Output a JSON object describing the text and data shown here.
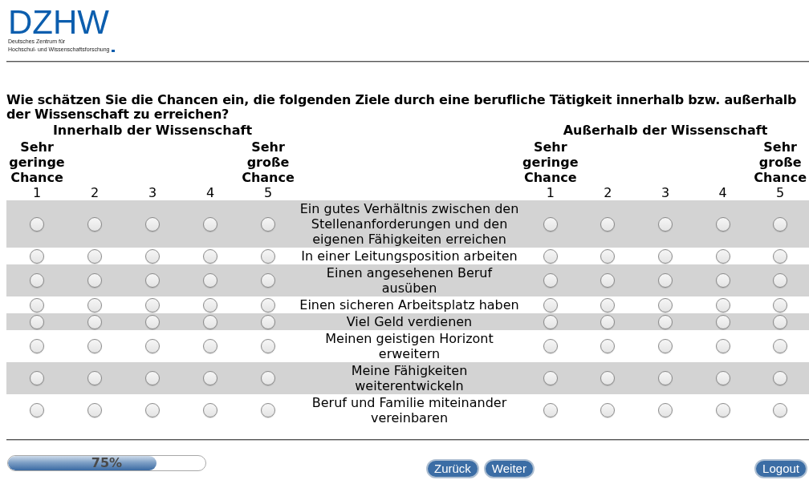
{
  "logo": {
    "wordmark": "DZHW",
    "subtitle_lines": [
      "Deutsches Zentrum für",
      "Hochschul- und Wissenschaftsforschung"
    ]
  },
  "question": "Wie schätzen Sie die Chancen ein, die folgenden Ziele durch eine berufliche Tätigkeit innerhalb bzw. außerhalb der Wissenschaft zu erreichen?",
  "scales": [
    {
      "title": "Innerhalb der Wissenschaft",
      "points": [
        {
          "label": "Sehr geringe Chance",
          "number": "1"
        },
        {
          "number": "2"
        },
        {
          "number": "3"
        },
        {
          "number": "4"
        },
        {
          "label": "Sehr große Chance",
          "number": "5"
        }
      ]
    },
    {
      "title": "Außerhalb der Wissenschaft",
      "points": [
        {
          "label": "Sehr geringe Chance",
          "number": "1"
        },
        {
          "number": "2"
        },
        {
          "number": "3"
        },
        {
          "number": "4"
        },
        {
          "label": "Sehr große Chance",
          "number": "5"
        }
      ]
    }
  ],
  "items": [
    {
      "text": "Ein gutes Verhältnis zwischen den Stellenanforderungen und den eigenen Fähigkeiten erreichen",
      "responses": [
        [
          {
            "selected": false
          },
          {
            "selected": false
          },
          {
            "selected": false
          },
          {
            "selected": false
          },
          {
            "selected": false
          }
        ],
        [
          {
            "selected": false
          },
          {
            "selected": false
          },
          {
            "selected": false
          },
          {
            "selected": false
          },
          {
            "selected": false
          }
        ]
      ]
    },
    {
      "text": "In einer Leitungsposition arbeiten",
      "responses": [
        [
          {
            "selected": false
          },
          {
            "selected": false
          },
          {
            "selected": false
          },
          {
            "selected": false
          },
          {
            "selected": false
          }
        ],
        [
          {
            "selected": false
          },
          {
            "selected": false
          },
          {
            "selected": false
          },
          {
            "selected": false
          },
          {
            "selected": false
          }
        ]
      ]
    },
    {
      "text": "Einen angesehenen Beruf ausüben",
      "responses": [
        [
          {
            "selected": false
          },
          {
            "selected": false
          },
          {
            "selected": false
          },
          {
            "selected": false
          },
          {
            "selected": false
          }
        ],
        [
          {
            "selected": false
          },
          {
            "selected": false
          },
          {
            "selected": false
          },
          {
            "selected": false
          },
          {
            "selected": false
          }
        ]
      ]
    },
    {
      "text": "Einen sicheren Arbeitsplatz haben",
      "responses": [
        [
          {
            "selected": false
          },
          {
            "selected": false
          },
          {
            "selected": false
          },
          {
            "selected": false
          },
          {
            "selected": false
          }
        ],
        [
          {
            "selected": false
          },
          {
            "selected": false
          },
          {
            "selected": false
          },
          {
            "selected": false
          },
          {
            "selected": false
          }
        ]
      ]
    },
    {
      "text": "Viel Geld verdienen",
      "responses": [
        [
          {
            "selected": false
          },
          {
            "selected": false
          },
          {
            "selected": false
          },
          {
            "selected": false
          },
          {
            "selected": false
          }
        ],
        [
          {
            "selected": false
          },
          {
            "selected": false
          },
          {
            "selected": false
          },
          {
            "selected": false
          },
          {
            "selected": false
          }
        ]
      ]
    },
    {
      "text": "Meinen geistigen Horizont erweitern",
      "responses": [
        [
          {
            "selected": false
          },
          {
            "selected": false
          },
          {
            "selected": false
          },
          {
            "selected": false
          },
          {
            "selected": false
          }
        ],
        [
          {
            "selected": false
          },
          {
            "selected": false
          },
          {
            "selected": false
          },
          {
            "selected": false
          },
          {
            "selected": false
          }
        ]
      ]
    },
    {
      "text": "Meine Fähigkeiten weiterentwickeln",
      "responses": [
        [
          {
            "selected": false
          },
          {
            "selected": false
          },
          {
            "selected": false
          },
          {
            "selected": false
          },
          {
            "selected": false
          }
        ],
        [
          {
            "selected": false
          },
          {
            "selected": false
          },
          {
            "selected": false
          },
          {
            "selected": false
          },
          {
            "selected": false
          }
        ]
      ]
    },
    {
      "text": "Beruf und Familie miteinander vereinbaren",
      "responses": [
        [
          {
            "selected": false
          },
          {
            "selected": false
          },
          {
            "selected": false
          },
          {
            "selected": false
          },
          {
            "selected": false
          }
        ],
        [
          {
            "selected": false
          },
          {
            "selected": false
          },
          {
            "selected": false
          },
          {
            "selected": false
          },
          {
            "selected": false
          }
        ]
      ]
    }
  ],
  "progress": {
    "label": "75%",
    "level": 0.75
  },
  "navigation": [
    {
      "label": "Zurück"
    },
    {
      "label": "Weiter"
    }
  ],
  "logout": {
    "label": "Logout"
  }
}
